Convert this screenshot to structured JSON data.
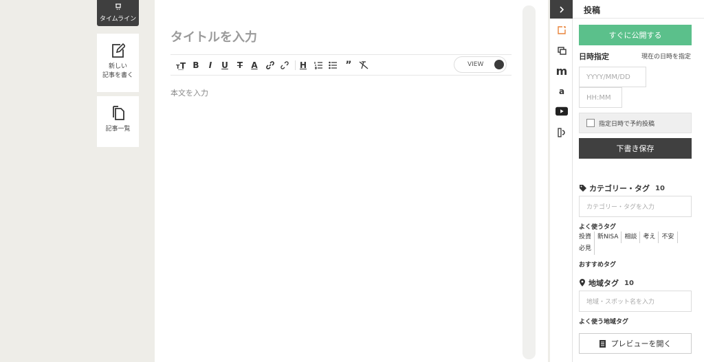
{
  "left_nav": {
    "timeline_label": "タイムライン",
    "new_post_label_1": "新しい",
    "new_post_label_2": "記事を書く",
    "post_list_label": "記事一覧"
  },
  "editor": {
    "title_placeholder": "タイトルを入力",
    "body_placeholder": "本文を入力",
    "view_toggle_label": "VIEW",
    "toolbar_icons": [
      "text-size-icon",
      "bold-icon",
      "italic-icon",
      "underline-icon",
      "strikethrough-icon",
      "text-color-icon",
      "link-icon",
      "unlink-icon",
      "heading-icon",
      "ordered-list-icon",
      "bullet-list-icon",
      "quote-icon",
      "clear-format-icon"
    ]
  },
  "side_strip": {
    "icons": [
      "edit-icon",
      "media-icon",
      "m-icon",
      "amazon-icon",
      "youtube-icon",
      "quote-box-icon"
    ]
  },
  "panel": {
    "header_title": "投稿",
    "publish_now": "すぐに公開する",
    "datetime_label": "日時指定",
    "set_now_link": "現在の日時を指定",
    "date_placeholder": "YYYY/MM/DD",
    "time_placeholder": "HH:MM",
    "schedule_checkbox_label": "指定日時で予約投稿",
    "save_draft": "下書き保存",
    "category_title": "カテゴリー・タグ",
    "category_count": "10",
    "category_placeholder": "カテゴリー・タグを入力",
    "frequent_tags_title": "よく使うタグ",
    "frequent_tags": [
      "投資",
      "新NISA",
      "相談",
      "考え",
      "不安",
      "必見"
    ],
    "recommended_tags_title": "おすすめタグ",
    "area_title": "地域タグ",
    "area_count": "10",
    "area_placeholder": "地域・スポット名を入力",
    "frequent_area_title": "よく使う地域タグ",
    "preview_button": "プレビューを開く"
  },
  "colors": {
    "publish_green": "#5bc08b",
    "dark": "#404040",
    "accent_orange": "#e8833a"
  }
}
